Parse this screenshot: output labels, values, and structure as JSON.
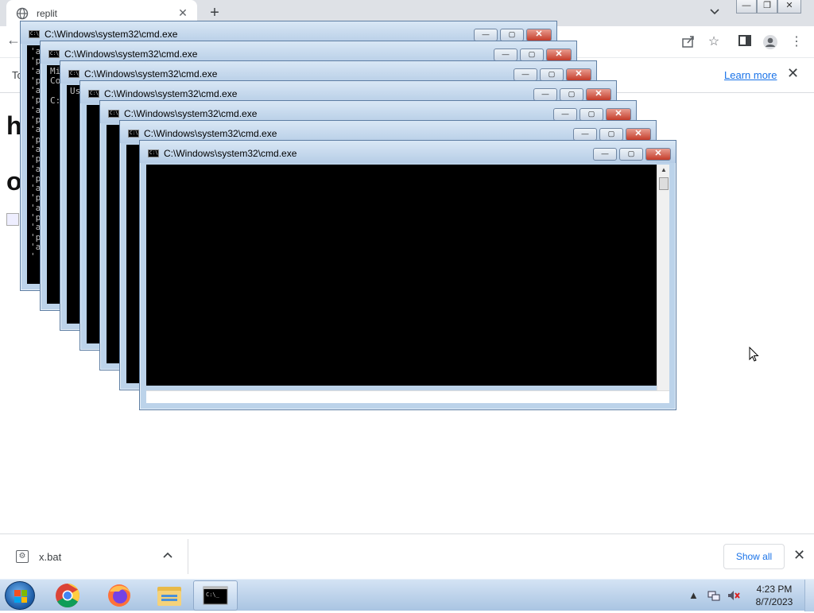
{
  "browser": {
    "tab_title": "replit",
    "tab_close": "✕",
    "new_tab": "+",
    "infobar_text": "To get",
    "learn_more": "Learn more",
    "infobar_close": "✕"
  },
  "page": {
    "heading1": "h",
    "heading2": "ope"
  },
  "cmd_windows": [
    {
      "title": "C:\\Windows\\system32\\cmd.exe",
      "lines": "'a\n'p\n'a\n'p\n'a\n'p\n'a\n'p\n'a\n'p\n'a\n'p\n'a\n'p\n'a\n'p\n'a\n'p\n'a\n'p\n'a\n'"
    },
    {
      "title": "C:\\Windows\\system32\\cmd.exe",
      "lines": "Mi\nCo\n\nC:"
    },
    {
      "title": "C:\\Windows\\system32\\cmd.exe",
      "lines": "Us"
    },
    {
      "title": "C:\\Windows\\system32\\cmd.exe",
      "lines": ""
    },
    {
      "title": "C:\\Windows\\system32\\cmd.exe",
      "lines": ""
    },
    {
      "title": "C:\\Windows\\system32\\cmd.exe",
      "lines": ""
    },
    {
      "title": "C:\\Windows\\system32\\cmd.exe",
      "lines": ""
    }
  ],
  "cmd_buttons": {
    "minimize": "—",
    "maximize": "▢",
    "close": "✕"
  },
  "cmd_icon_text": "C:\\",
  "download": {
    "file_name": "x.bat",
    "show_all": "Show all",
    "caret": "^",
    "close": "✕"
  },
  "taskbar": {
    "time": "4:23 PM",
    "date": "8/7/2023",
    "apps": [
      "chrome",
      "firefox",
      "file-explorer",
      "cmd"
    ]
  },
  "colors": {
    "accent": "#1a73e8",
    "taskbar": "#bcd3ea",
    "cmd_close": "#c43c2a"
  }
}
